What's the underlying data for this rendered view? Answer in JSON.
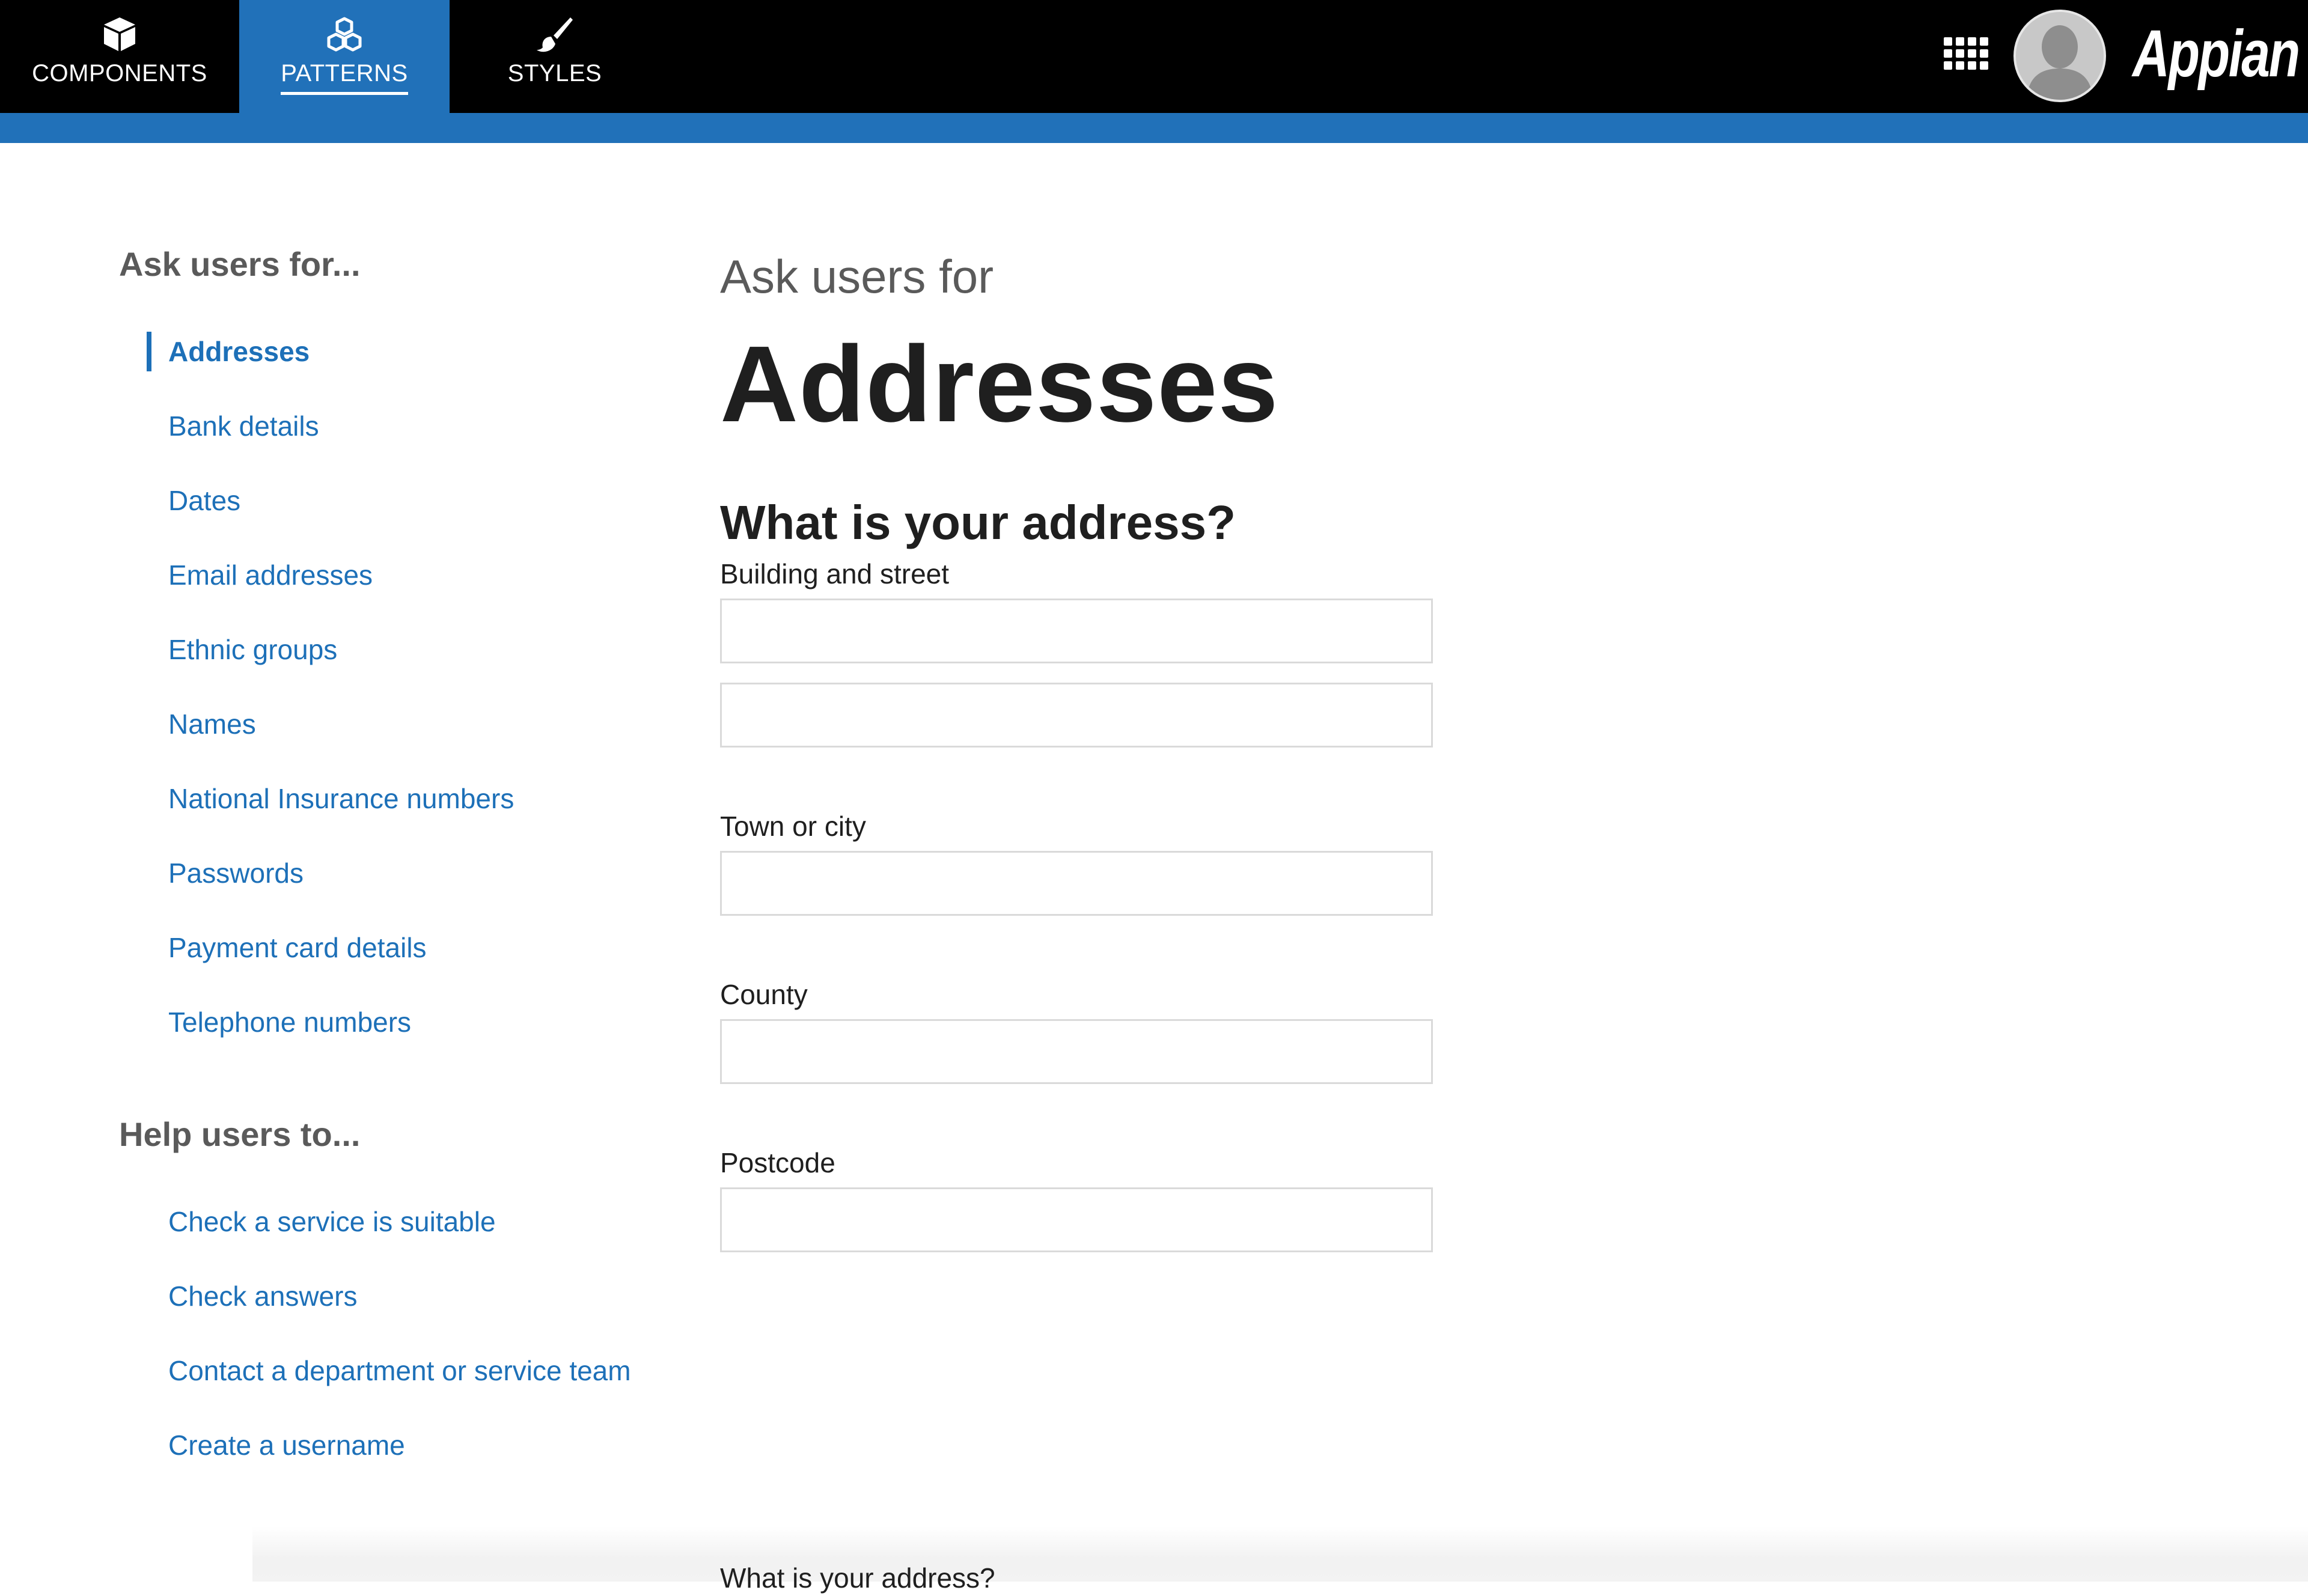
{
  "top_nav": {
    "tabs": [
      {
        "label": "COMPONENTS",
        "icon": "cube-icon"
      },
      {
        "label": "PATTERNS",
        "icon": "cubes-icon",
        "active": true
      },
      {
        "label": "STYLES",
        "icon": "paintbrush-icon"
      }
    ],
    "brand": "Appian",
    "apps_icon": "apps-grid-icon",
    "avatar_icon": "user-avatar-icon"
  },
  "colors": {
    "nav_background": "#000000",
    "accent": "#2171b9",
    "link": "#1d70b8",
    "heading": "#1f1f1f",
    "muted": "#5a5a5a"
  },
  "sidebar": {
    "heading_ask": "Ask users for...",
    "ask_items": [
      {
        "label": "Addresses",
        "active": true
      },
      {
        "label": "Bank details"
      },
      {
        "label": "Dates"
      },
      {
        "label": "Email addresses"
      },
      {
        "label": "Ethnic groups"
      },
      {
        "label": "Names"
      },
      {
        "label": "National Insurance numbers"
      },
      {
        "label": "Passwords"
      },
      {
        "label": "Payment card details"
      },
      {
        "label": "Telephone numbers"
      }
    ],
    "heading_help": "Help users to...",
    "help_items": [
      {
        "label": "Check a service is suitable"
      },
      {
        "label": "Check answers"
      },
      {
        "label": "Contact a department or service team"
      },
      {
        "label": "Create a username"
      }
    ]
  },
  "main": {
    "caption": "Ask users for",
    "title": "Addresses",
    "question": "What is your address?",
    "fields": {
      "building_label": "Building and street",
      "building_line1": "",
      "building_line2": "",
      "town_label": "Town or city",
      "town_value": "",
      "county_label": "County",
      "county_value": "",
      "postcode_label": "Postcode",
      "postcode_value": ""
    },
    "peek_text": "What is your address?"
  }
}
